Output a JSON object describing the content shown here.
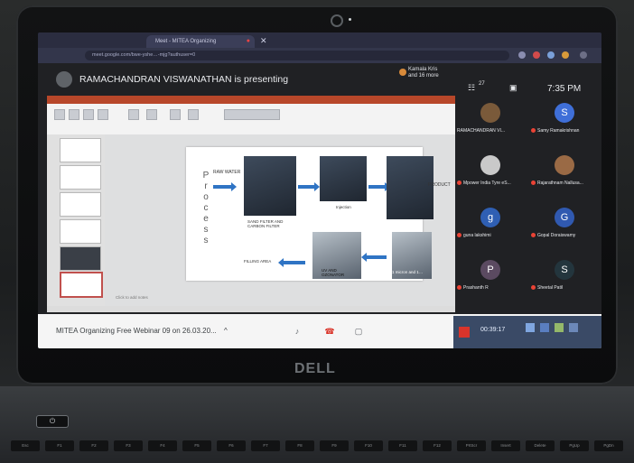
{
  "browser": {
    "tab_title": "Meet - MITEA Organizing",
    "url": "meet.google.com/bwe-yshe…-mjg?authuser=0"
  },
  "meet": {
    "presenting_text": "RAMACHANDRAN VISWANATHAN is presenting",
    "others_line1": "Kamala Kris",
    "others_line2": "and 16 more",
    "participant_count": "27",
    "time": "7:35 PM",
    "meeting_title": "MITEA Organizing Free Webinar 09 on 26.03.20...",
    "chevron": "^",
    "tray_timer": "00:39:17"
  },
  "slide": {
    "vertical_word": [
      "P",
      "r",
      "o",
      "c",
      "e",
      "s",
      "s"
    ],
    "raw_water": "RAW WATER",
    "sand_filter": "SAND FILTER AND\nCARBON FILTER",
    "injection": "Injection",
    "product": "PRODUCT",
    "filling_area": "FILLING AREA",
    "uv_ozonator": "UV AND\nOZONATOR",
    "micron": "1 micron and 1…",
    "notes_placeholder": "Click to add notes"
  },
  "participants": [
    {
      "name": "RAMACHANDRAN VI...",
      "initial": "",
      "color": "#7a5a3a",
      "muted": false
    },
    {
      "name": "Samy Ramakrishnan",
      "initial": "S",
      "color": "#3f6fd8",
      "muted": true
    },
    {
      "name": "Mpower India Tyre eS...",
      "initial": "",
      "color": "#c9c9c9",
      "muted": true
    },
    {
      "name": "Rajarathnam Nallusa...",
      "initial": "",
      "color": "#9a6a45",
      "muted": true
    },
    {
      "name": "guna lakshimi",
      "initial": "g",
      "color": "#2f5fb3",
      "muted": true
    },
    {
      "name": "Gopal Doraiswamy",
      "initial": "G",
      "color": "#3059b0",
      "muted": true
    },
    {
      "name": "Prashanth R",
      "initial": "P",
      "color": "#5b4a61",
      "muted": true
    },
    {
      "name": "Sheetal Patil",
      "initial": "S",
      "color": "#23353d",
      "muted": true
    }
  ],
  "laptop": {
    "brand": "DELL",
    "keys": [
      "Esc",
      "F1",
      "F2",
      "F3",
      "F4",
      "F5",
      "F6",
      "F7",
      "F8",
      "F9",
      "F10",
      "F11",
      "F12",
      "PrtScr",
      "Insert",
      "Delete",
      "PgUp",
      "PgDn"
    ]
  },
  "icons": [
    "camera-icon",
    "present-icon",
    "people-icon",
    "chat-icon",
    "mic-icon",
    "hangup-icon",
    "screen-share-icon",
    "power-icon"
  ]
}
